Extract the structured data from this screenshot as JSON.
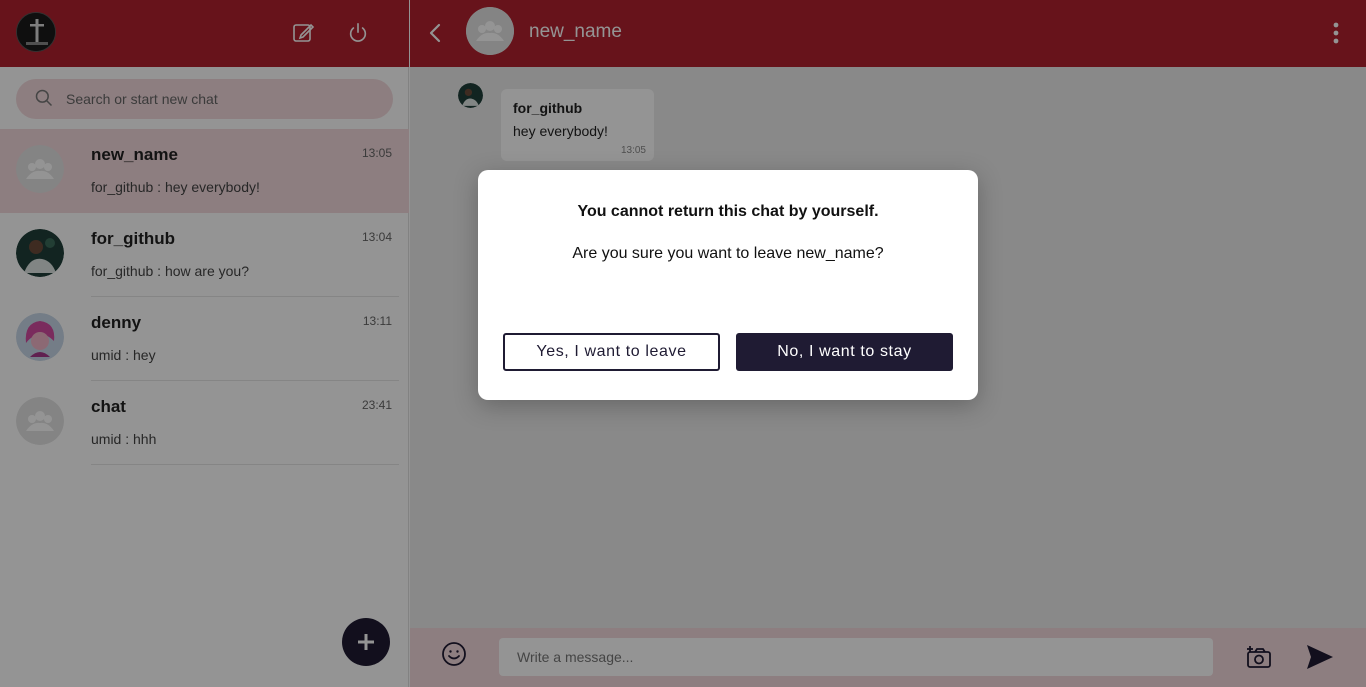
{
  "left_header": {
    "avatar_icon": "profile-avatar",
    "new_chat_icon": "edit-icon",
    "logout_icon": "power-icon"
  },
  "search": {
    "placeholder": "Search or start new chat"
  },
  "chats": [
    {
      "name": "new_name",
      "time": "13:05",
      "last": "for_github : hey everybody!",
      "avatar": "group-avatar",
      "active": true
    },
    {
      "name": "for_github",
      "time": "13:04",
      "last": "for_github : how are you?",
      "avatar": "photo-avatar",
      "active": false
    },
    {
      "name": "denny",
      "time": "13:11",
      "last": "umid : hey",
      "avatar": "cartoon-avatar",
      "active": false
    },
    {
      "name": "chat",
      "time": "23:41",
      "last": "umid : hhh",
      "avatar": "group-avatar",
      "active": false
    }
  ],
  "fab": {
    "icon": "plus-icon"
  },
  "conversation": {
    "title": "new_name",
    "message": {
      "sender": "for_github",
      "text": "hey everybody!",
      "time": "13:05"
    }
  },
  "composer": {
    "placeholder": "Write a message...",
    "emoji_icon": "smiley-icon",
    "camera_icon": "camera-icon",
    "send_icon": "send-icon"
  },
  "modal": {
    "title": "You cannot return this chat by yourself.",
    "body": "Are you sure you want to leave new_name?",
    "leave_label": "Yes, I want to leave",
    "stay_label": "No, I want to stay"
  },
  "colors": {
    "brand": "#b2222f",
    "accent_light": "#f3d9dc",
    "dark": "#1f1b33"
  }
}
